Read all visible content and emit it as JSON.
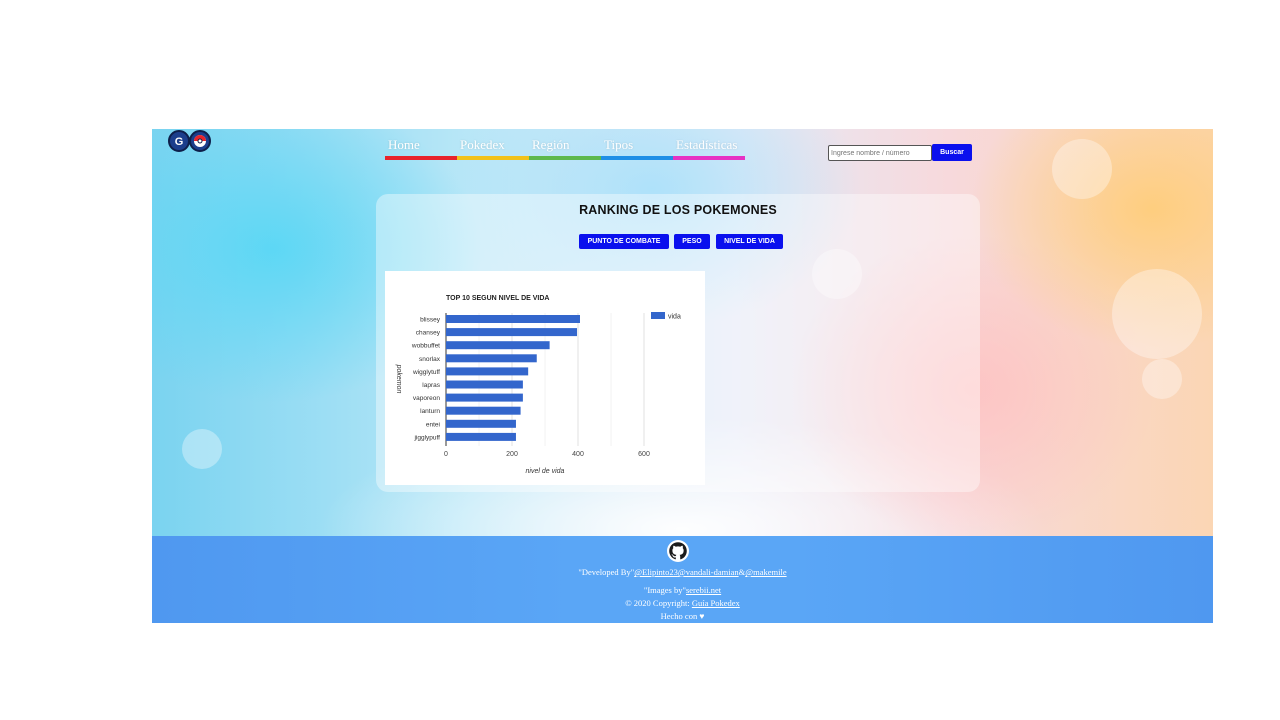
{
  "nav": {
    "items": [
      {
        "label": "Home",
        "color": "#e8232b"
      },
      {
        "label": "Pokedex",
        "color": "#f2c21b"
      },
      {
        "label": "Región",
        "color": "#5db84d"
      },
      {
        "label": "Tipos",
        "color": "#1f8fe6"
      },
      {
        "label": "Estadísticas",
        "color": "#e632c4"
      }
    ]
  },
  "search": {
    "placeholder": "Ingrese nombre / número",
    "button_label": "Buscar"
  },
  "ranking": {
    "title": "RANKING DE LOS POKEMONES",
    "buttons": [
      "PUNTO DE COMBATE",
      "PESO",
      "NIVEL DE VIDA"
    ]
  },
  "chart_data": {
    "type": "bar",
    "orientation": "horizontal",
    "title": "TOP 10 SEGUN NIVEL DE VIDA",
    "xlabel": "nivel de vida",
    "ylabel": "pokemon",
    "categories": [
      "blissey",
      "chansey",
      "wobbuffet",
      "snorlax",
      "wigglytuff",
      "lapras",
      "vaporeon",
      "lanturn",
      "entei",
      "jigglypuff"
    ],
    "series": [
      {
        "name": "vida",
        "color": "#3366cc",
        "values": [
          406,
          397,
          314,
          275,
          249,
          233,
          233,
          226,
          212,
          212
        ]
      }
    ],
    "xlim": [
      0,
      700
    ],
    "xticks": [
      0,
      200,
      400,
      600
    ],
    "legend": "right"
  },
  "footer": {
    "developed_prefix": "\"Developed By\"",
    "dev1": "@Elipinto23",
    "dev2": "@vandali-damian",
    "amp": "&",
    "dev3": "@makemile",
    "images_prefix": "\"Images by\"",
    "images_link": "serebii.net",
    "copyright_prefix": "© 2020 Copyright:",
    "copyright_link": "Guía Pokedex",
    "made_with": "Hecho con ♥"
  }
}
